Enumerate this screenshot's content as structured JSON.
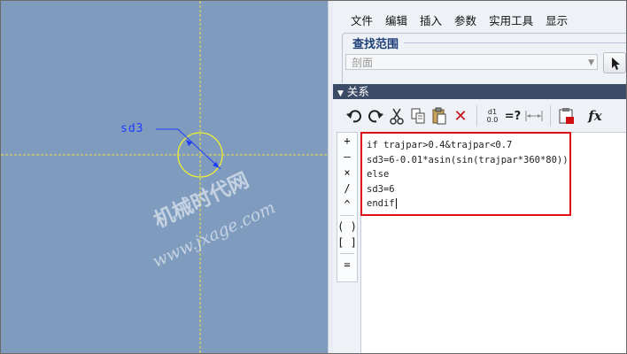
{
  "sketch": {
    "dimension_label": "sd3",
    "watermark_cn": "机械时代网",
    "watermark_url": "www.jxage.com",
    "colors": {
      "background": "#7f9cbf",
      "centerline": "#f0e040",
      "circle": "#f2ef30",
      "dimension": "#1e3cff"
    }
  },
  "menubar": {
    "items": [
      "文件",
      "编辑",
      "插入",
      "参数",
      "实用工具",
      "显示"
    ]
  },
  "search": {
    "title": "查找范围",
    "filter_value": "剖面"
  },
  "relations": {
    "title": "关系",
    "toolbar_icons": [
      "undo-icon",
      "redo-icon",
      "cut-icon",
      "copy-icon",
      "paste-icon",
      "delete-icon",
      "evaluate-icon",
      "verify-icon",
      "dimension-toggle-icon",
      "sort-icon",
      "function-icon"
    ],
    "toolbar_verify_label": "=?",
    "toolbar_function_label": "fx",
    "evaluate_top": "d1",
    "evaluate_bottom": "0.0",
    "operators": [
      "+",
      "–",
      "×",
      "/",
      "^",
      "( )",
      "[ ]",
      "="
    ],
    "code_lines": [
      "if trajpar>0.4&trajpar<0.7",
      "sd3=6-0.01*asin(sin(trajpar*360*80))",
      "else",
      "sd3=6",
      "endif"
    ],
    "highlight_color": "#e0101a"
  }
}
